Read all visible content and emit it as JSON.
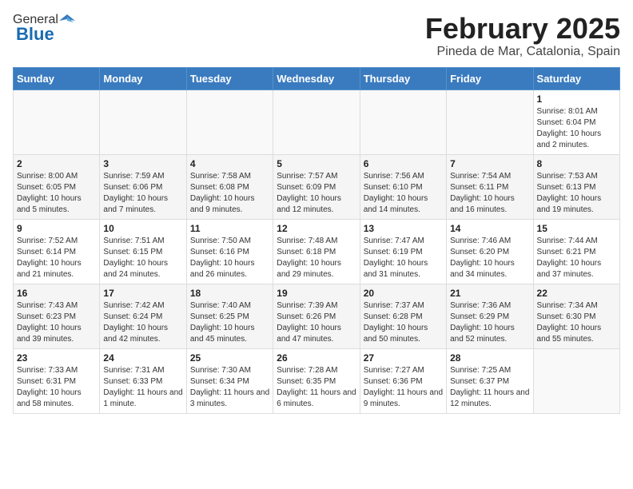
{
  "header": {
    "logo_general": "General",
    "logo_blue": "Blue",
    "title": "February 2025",
    "subtitle": "Pineda de Mar, Catalonia, Spain"
  },
  "calendar": {
    "days_of_week": [
      "Sunday",
      "Monday",
      "Tuesday",
      "Wednesday",
      "Thursday",
      "Friday",
      "Saturday"
    ],
    "weeks": [
      [
        {
          "day": "",
          "info": ""
        },
        {
          "day": "",
          "info": ""
        },
        {
          "day": "",
          "info": ""
        },
        {
          "day": "",
          "info": ""
        },
        {
          "day": "",
          "info": ""
        },
        {
          "day": "",
          "info": ""
        },
        {
          "day": "1",
          "info": "Sunrise: 8:01 AM\nSunset: 6:04 PM\nDaylight: 10 hours and 2 minutes."
        }
      ],
      [
        {
          "day": "2",
          "info": "Sunrise: 8:00 AM\nSunset: 6:05 PM\nDaylight: 10 hours and 5 minutes."
        },
        {
          "day": "3",
          "info": "Sunrise: 7:59 AM\nSunset: 6:06 PM\nDaylight: 10 hours and 7 minutes."
        },
        {
          "day": "4",
          "info": "Sunrise: 7:58 AM\nSunset: 6:08 PM\nDaylight: 10 hours and 9 minutes."
        },
        {
          "day": "5",
          "info": "Sunrise: 7:57 AM\nSunset: 6:09 PM\nDaylight: 10 hours and 12 minutes."
        },
        {
          "day": "6",
          "info": "Sunrise: 7:56 AM\nSunset: 6:10 PM\nDaylight: 10 hours and 14 minutes."
        },
        {
          "day": "7",
          "info": "Sunrise: 7:54 AM\nSunset: 6:11 PM\nDaylight: 10 hours and 16 minutes."
        },
        {
          "day": "8",
          "info": "Sunrise: 7:53 AM\nSunset: 6:13 PM\nDaylight: 10 hours and 19 minutes."
        }
      ],
      [
        {
          "day": "9",
          "info": "Sunrise: 7:52 AM\nSunset: 6:14 PM\nDaylight: 10 hours and 21 minutes."
        },
        {
          "day": "10",
          "info": "Sunrise: 7:51 AM\nSunset: 6:15 PM\nDaylight: 10 hours and 24 minutes."
        },
        {
          "day": "11",
          "info": "Sunrise: 7:50 AM\nSunset: 6:16 PM\nDaylight: 10 hours and 26 minutes."
        },
        {
          "day": "12",
          "info": "Sunrise: 7:48 AM\nSunset: 6:18 PM\nDaylight: 10 hours and 29 minutes."
        },
        {
          "day": "13",
          "info": "Sunrise: 7:47 AM\nSunset: 6:19 PM\nDaylight: 10 hours and 31 minutes."
        },
        {
          "day": "14",
          "info": "Sunrise: 7:46 AM\nSunset: 6:20 PM\nDaylight: 10 hours and 34 minutes."
        },
        {
          "day": "15",
          "info": "Sunrise: 7:44 AM\nSunset: 6:21 PM\nDaylight: 10 hours and 37 minutes."
        }
      ],
      [
        {
          "day": "16",
          "info": "Sunrise: 7:43 AM\nSunset: 6:23 PM\nDaylight: 10 hours and 39 minutes."
        },
        {
          "day": "17",
          "info": "Sunrise: 7:42 AM\nSunset: 6:24 PM\nDaylight: 10 hours and 42 minutes."
        },
        {
          "day": "18",
          "info": "Sunrise: 7:40 AM\nSunset: 6:25 PM\nDaylight: 10 hours and 45 minutes."
        },
        {
          "day": "19",
          "info": "Sunrise: 7:39 AM\nSunset: 6:26 PM\nDaylight: 10 hours and 47 minutes."
        },
        {
          "day": "20",
          "info": "Sunrise: 7:37 AM\nSunset: 6:28 PM\nDaylight: 10 hours and 50 minutes."
        },
        {
          "day": "21",
          "info": "Sunrise: 7:36 AM\nSunset: 6:29 PM\nDaylight: 10 hours and 52 minutes."
        },
        {
          "day": "22",
          "info": "Sunrise: 7:34 AM\nSunset: 6:30 PM\nDaylight: 10 hours and 55 minutes."
        }
      ],
      [
        {
          "day": "23",
          "info": "Sunrise: 7:33 AM\nSunset: 6:31 PM\nDaylight: 10 hours and 58 minutes."
        },
        {
          "day": "24",
          "info": "Sunrise: 7:31 AM\nSunset: 6:33 PM\nDaylight: 11 hours and 1 minute."
        },
        {
          "day": "25",
          "info": "Sunrise: 7:30 AM\nSunset: 6:34 PM\nDaylight: 11 hours and 3 minutes."
        },
        {
          "day": "26",
          "info": "Sunrise: 7:28 AM\nSunset: 6:35 PM\nDaylight: 11 hours and 6 minutes."
        },
        {
          "day": "27",
          "info": "Sunrise: 7:27 AM\nSunset: 6:36 PM\nDaylight: 11 hours and 9 minutes."
        },
        {
          "day": "28",
          "info": "Sunrise: 7:25 AM\nSunset: 6:37 PM\nDaylight: 11 hours and 12 minutes."
        },
        {
          "day": "",
          "info": ""
        }
      ]
    ]
  }
}
